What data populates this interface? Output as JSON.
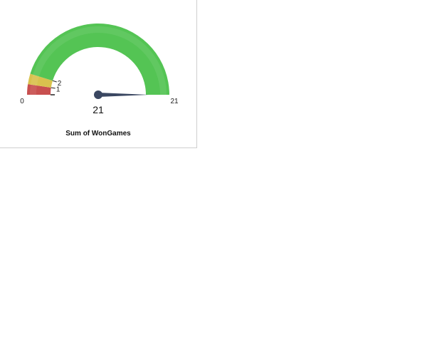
{
  "chart_data": {
    "type": "gauge",
    "min": 0,
    "max": 21,
    "value": 21,
    "value_label": "21",
    "title": "Sum of WonGames",
    "min_label": "0",
    "max_label": "21",
    "bands": [
      {
        "from": 0,
        "to": 1,
        "color": "#c8504f"
      },
      {
        "from": 1,
        "to": 2,
        "color": "#d9c24e"
      },
      {
        "from": 2,
        "to": 21,
        "color": "#54c454"
      }
    ],
    "band_labels": [
      "1",
      "2"
    ],
    "needle_color": "#3a4761"
  }
}
